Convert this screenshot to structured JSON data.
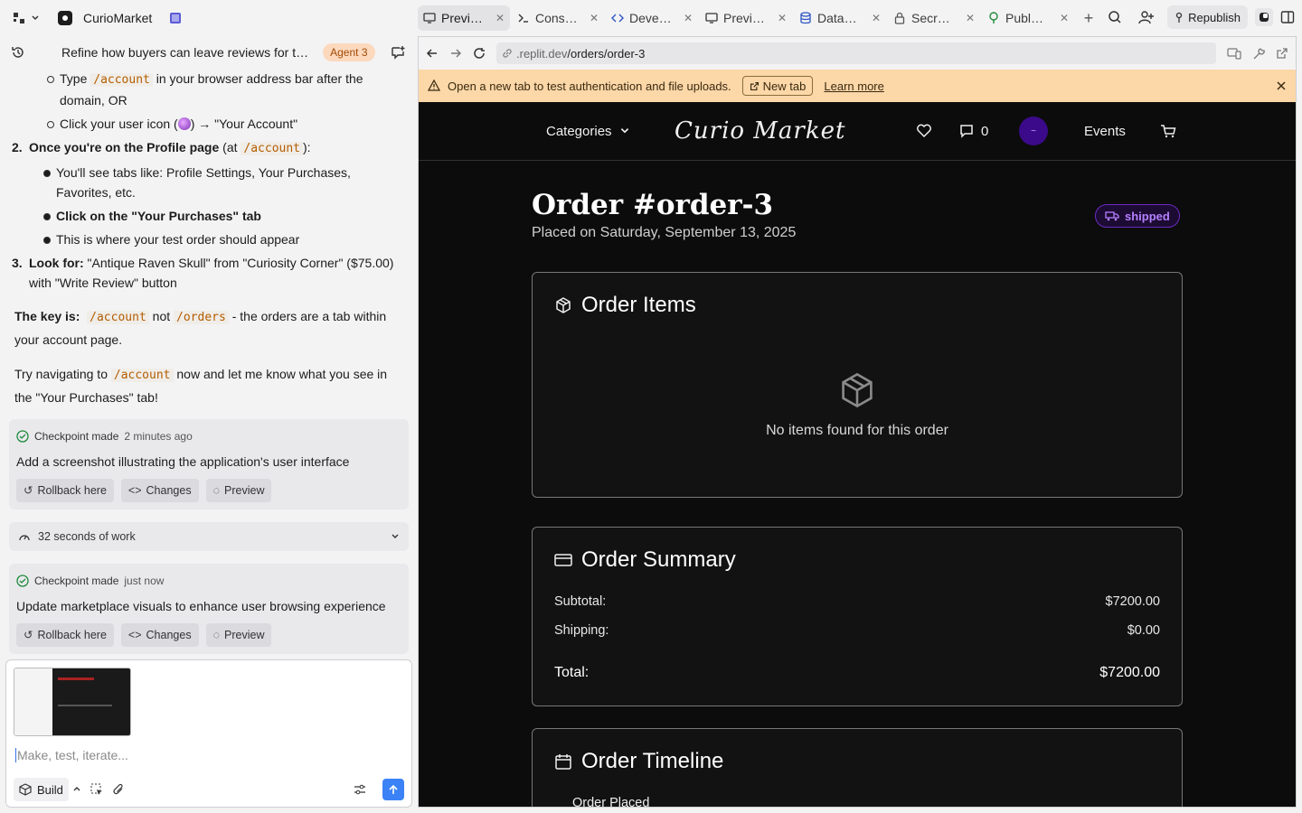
{
  "app": {
    "name": "CurioMarket"
  },
  "tabs": [
    {
      "label": "Previ…",
      "icon": "monitor-icon",
      "active": true
    },
    {
      "label": "Cons…",
      "icon": "terminal-icon"
    },
    {
      "label": "Deve…",
      "icon": "code-icon"
    },
    {
      "label": "Previ…",
      "icon": "monitor-icon"
    },
    {
      "label": "Data…",
      "icon": "database-icon"
    },
    {
      "label": "Secr…",
      "icon": "lock-icon"
    },
    {
      "label": "Publ…",
      "icon": "tree-icon"
    }
  ],
  "toolbar": {
    "republish_label": "Republish"
  },
  "chat": {
    "title": "Refine how buyers can leave reviews for t…",
    "agent_badge": "Agent 3",
    "item_type_pre": "Type ",
    "item_type_code": "/account",
    "item_type_post": " in your browser address bar after the domain, OR",
    "item_click_pre": "Click your user icon (",
    "item_click_post": ") → \"Your Account\"",
    "step2_num": "2.",
    "step2_bold": "Once you're on the Profile page",
    "step2_pre": " (at ",
    "step2_code": "/account",
    "step2_post": "):",
    "step2_items": [
      "You'll see tabs like: Profile Settings, Your Purchases, Favorites, etc.",
      "Click on the \"Your Purchases\" tab",
      "This is where your test order should appear"
    ],
    "step3_num": "3.",
    "step3_bold": "Look for:",
    "step3_text": " \"Antique Raven Skull\" from \"Curiosity Corner\" ($75.00) with \"Write Review\" button",
    "key_bold": "The key is:",
    "key_code1": "/account",
    "key_mid": " not ",
    "key_code2": "/orders",
    "key_post": " - the orders are a tab within your account page.",
    "try_pre": "Try navigating to ",
    "try_code": "/account",
    "try_post": " now and let me know what you see in the \"Your Purchases\" tab!",
    "checkpoint1": {
      "label": "Checkpoint made",
      "time": "2 minutes ago",
      "message": "Add a screenshot illustrating the application's user interface"
    },
    "work_label": "32 seconds of work",
    "checkpoint2": {
      "label": "Checkpoint made",
      "time": "just now",
      "message": "Update marketplace visuals to enhance user browsing experience"
    },
    "buttons": {
      "rollback": "Rollback here",
      "changes": "Changes",
      "preview": "Preview"
    }
  },
  "composer": {
    "placeholder": "Make, test, iterate...",
    "build_label": "Build"
  },
  "browser": {
    "url_domain": ".replit.dev",
    "url_path": "/orders/order-3"
  },
  "banner": {
    "text": "Open a new tab to test authentication and file uploads.",
    "newtab_label": "New tab",
    "learn_label": "Learn more"
  },
  "site": {
    "nav": {
      "categories": "Categories",
      "logo": "Curio Market",
      "messages_count": "0",
      "events": "Events",
      "avatar_text": "~"
    },
    "order": {
      "title": "Order #order-3",
      "placed": "Placed on Saturday, September 13, 2025",
      "status": "shipped"
    },
    "items_panel": {
      "title": "Order Items",
      "empty_text": "No items found for this order"
    },
    "summary": {
      "title": "Order Summary",
      "subtotal_label": "Subtotal:",
      "subtotal_value": "$7200.00",
      "shipping_label": "Shipping:",
      "shipping_value": "$0.00",
      "total_label": "Total:",
      "total_value": "$7200.00"
    },
    "timeline": {
      "title": "Order Timeline",
      "first_event": "Order Placed"
    }
  },
  "colors": {
    "accent": "#3b82f6",
    "status_purple": "#b580ff",
    "banner": "#fcd7a8",
    "site_bg": "#0c0c0c"
  }
}
